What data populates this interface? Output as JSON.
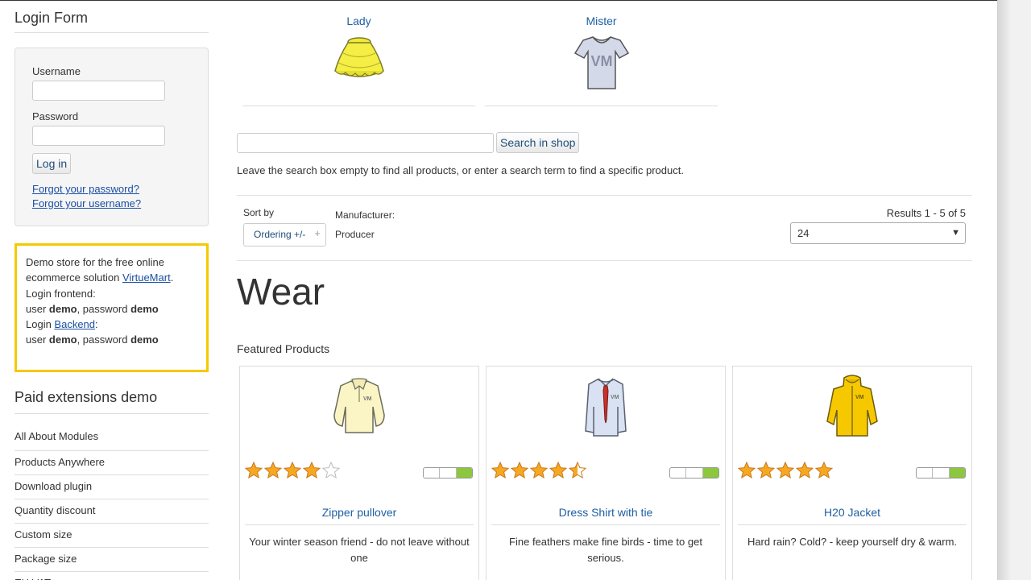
{
  "sidebar": {
    "login_title": "Login Form",
    "username_label": "Username",
    "password_label": "Password",
    "login_button": "Log in",
    "forgot_password": "Forgot your password?",
    "forgot_username": "Forgot your username?",
    "demo": {
      "line1": "Demo store for the free online ecommerce solution ",
      "link1": "VirtueMart",
      "line1_end": ".",
      "line2": "Login frontend:",
      "user_prefix": "user ",
      "user": "demo",
      "pass_prefix": ", password ",
      "pass": "demo",
      "login_prefix": "Login ",
      "backend_link": "Backend",
      "login_suffix": ":",
      "user2": "demo",
      "pass2": "demo"
    },
    "paid_title": "Paid extensions demo",
    "menu": [
      "All About Modules",
      "Products Anywhere",
      "Download plugin",
      "Quantity discount",
      "Custom size",
      "Package size",
      "EU VAT"
    ]
  },
  "categories": [
    {
      "name": "Lady",
      "icon": "skirt-icon"
    },
    {
      "name": "Mister",
      "icon": "tshirt-icon"
    }
  ],
  "search": {
    "value": "",
    "button": "Search in shop",
    "hint": "Leave the search box empty to find all products, or enter a search term to find a specific product."
  },
  "ordering": {
    "sort_by": "Sort by",
    "sort_value": "Ordering +/-",
    "manufacturer_label": "Manufacturer:",
    "manufacturer_value": "Producer",
    "results": "Results 1 - 5 of 5",
    "per_page": "24"
  },
  "category_title": "Wear",
  "featured_title": "Featured Products",
  "products": [
    {
      "name": "Zipper pullover",
      "description": "Your winter season friend - do not leave without one",
      "rating": 4,
      "icon": "pullover-icon",
      "stock": "in-stock"
    },
    {
      "name": "Dress Shirt with tie",
      "description": "Fine feathers make fine birds - time to get serious.",
      "rating": 4.5,
      "icon": "shirt-tie-icon",
      "stock": "in-stock"
    },
    {
      "name": "H20 Jacket",
      "description": "Hard rain? Cold? - keep yourself dry & warm.",
      "rating": 5,
      "icon": "jacket-icon",
      "stock": "in-stock"
    }
  ],
  "colors": {
    "accent_link": "#1f5fa3",
    "demo_border": "#f5c900",
    "stock_green": "#8dc63f",
    "star": "#f7a823"
  }
}
